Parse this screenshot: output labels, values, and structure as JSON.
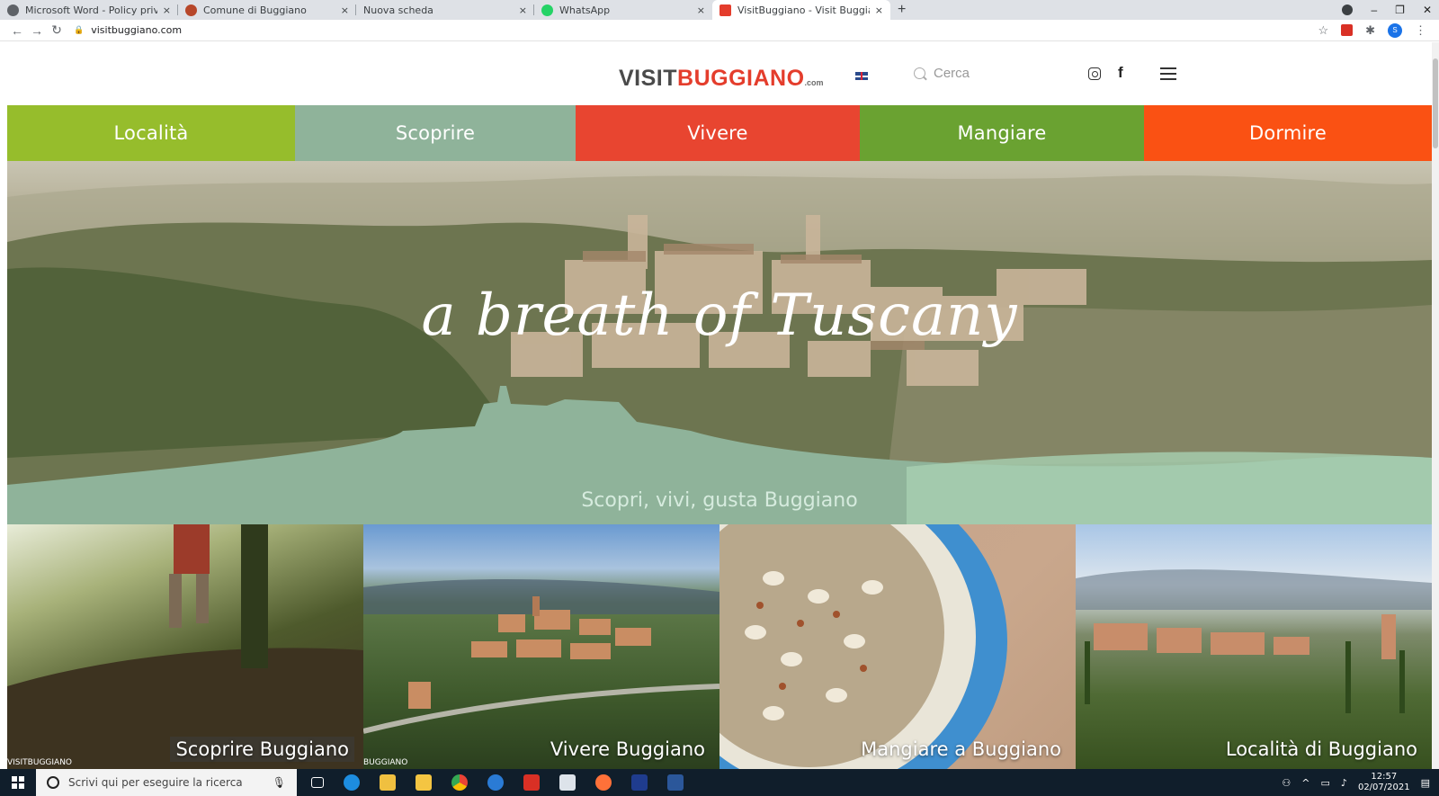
{
  "browser": {
    "tabs": [
      {
        "title": "Microsoft Word - Policy privacy_i",
        "favicon_color": "#5f6368",
        "active": false
      },
      {
        "title": "Comune di Buggiano",
        "favicon_color": "#b7472a",
        "active": false
      },
      {
        "title": "Nuova scheda",
        "favicon_color": "",
        "active": false
      },
      {
        "title": "WhatsApp",
        "favicon_color": "#25d366",
        "active": false
      },
      {
        "title": "VisitBuggiano - Visit Buggiano",
        "favicon_color": "#e43d2c",
        "active": true
      }
    ],
    "close_glyph": "×",
    "new_tab_glyph": "+",
    "url": "visitbuggiano.com"
  },
  "site": {
    "logo": {
      "part1": "VISIT",
      "part2": "BUGGIANO",
      "part3": ".com"
    },
    "search_placeholder": "Cerca",
    "fb_glyph": "f",
    "nav": [
      {
        "label": "Località",
        "color": "#96bd2c"
      },
      {
        "label": "Scoprire",
        "color": "#8fb39a"
      },
      {
        "label": "Vivere",
        "color": "#e84530"
      },
      {
        "label": "Mangiare",
        "color": "#6aa231"
      },
      {
        "label": "Dormire",
        "color": "#fa5113"
      }
    ],
    "hero": {
      "tagline": "a breath of Tuscany",
      "caption": "Scopri, vivi, gusta Buggiano",
      "band_color": "#8fb39a"
    },
    "cards": [
      {
        "label": "Scoprire Buggiano",
        "watermark": "VISITBUGGIANO"
      },
      {
        "label": "Vivere Buggiano",
        "watermark": "BUGGIANO"
      },
      {
        "label": "Mangiare a Buggiano",
        "watermark": ""
      },
      {
        "label": "Località di Buggiano",
        "watermark": ""
      }
    ]
  },
  "taskbar": {
    "search_placeholder": "Scrivi qui per eseguire la ricerca",
    "time": "12:57",
    "date": "02/07/2021"
  }
}
